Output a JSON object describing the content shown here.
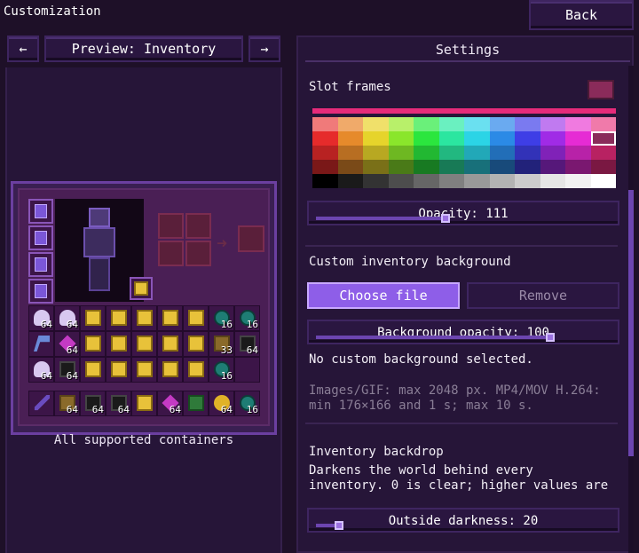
{
  "header": {
    "title": "Customization",
    "back_label": "Back"
  },
  "preview_nav": {
    "prev_icon": "arrow-left-icon",
    "prev_glyph": "←",
    "label": "Preview: Inventory",
    "next_icon": "arrow-right-icon",
    "next_glyph": "→"
  },
  "preview": {
    "caption": "All supported containers",
    "main_grid": [
      {
        "item": "potion",
        "count": "64"
      },
      {
        "item": "potion",
        "count": "64"
      },
      {
        "item": "totem",
        "count": ""
      },
      {
        "item": "totem",
        "count": ""
      },
      {
        "item": "totem",
        "count": ""
      },
      {
        "item": "totem",
        "count": ""
      },
      {
        "item": "totem",
        "count": ""
      },
      {
        "item": "pearl",
        "count": "16"
      },
      {
        "item": "pearl",
        "count": "16"
      },
      {
        "item": "axe",
        "count": ""
      },
      {
        "item": "crystal",
        "count": "64"
      },
      {
        "item": "totem",
        "count": ""
      },
      {
        "item": "totem",
        "count": ""
      },
      {
        "item": "totem",
        "count": ""
      },
      {
        "item": "totem",
        "count": ""
      },
      {
        "item": "totem",
        "count": ""
      },
      {
        "item": "anchor",
        "count": "33"
      },
      {
        "item": "block",
        "count": "64"
      },
      {
        "item": "potion",
        "count": "64"
      },
      {
        "item": "block",
        "count": "64"
      },
      {
        "item": "totem",
        "count": ""
      },
      {
        "item": "totem",
        "count": ""
      },
      {
        "item": "totem",
        "count": ""
      },
      {
        "item": "totem",
        "count": ""
      },
      {
        "item": "totem",
        "count": ""
      },
      {
        "item": "pearl",
        "count": "16"
      },
      {
        "item": "",
        "count": ""
      }
    ],
    "hotbar": [
      {
        "item": "sword",
        "count": ""
      },
      {
        "item": "anchor",
        "count": "64"
      },
      {
        "item": "block",
        "count": "64"
      },
      {
        "item": "block",
        "count": "64"
      },
      {
        "item": "totem",
        "count": ""
      },
      {
        "item": "crystal",
        "count": "64"
      },
      {
        "item": "emerald",
        "count": ""
      },
      {
        "item": "apple",
        "count": "64"
      },
      {
        "item": "pearl",
        "count": "16"
      }
    ]
  },
  "settings": {
    "heading": "Settings",
    "slot_frames_label": "Slot frames",
    "selected_color": "#8a2b5a",
    "opacity_slider": {
      "label": "Opacity: 111",
      "value": 111,
      "max": 255
    },
    "custom_bg_label": "Custom inventory background",
    "choose_file_label": "Choose file",
    "remove_label": "Remove",
    "bg_opacity_slider": {
      "label": "Background opacity: 100",
      "value": 100,
      "max": 100
    },
    "no_bg_text": "No custom background selected.",
    "formats_line1": "Images/GIF: max 2048 px. MP4/MOV H.264:",
    "formats_line2": "min 176×166 and 1 s; max 10 s.",
    "backdrop_label": "Inventory backdrop",
    "backdrop_desc1": "Darkens the world behind every",
    "backdrop_desc2": "inventory. 0 is clear; higher values are",
    "darkness_slider": {
      "label": "Outside darkness: 20",
      "value": 20,
      "max": 255
    }
  },
  "palette_colors": [
    "#f07a7a",
    "#f0aa6a",
    "#f0e06a",
    "#b8f06a",
    "#6af07a",
    "#6af0c0",
    "#6ae0f0",
    "#6aaaf0",
    "#7a7af0",
    "#c07af0",
    "#f07ae0",
    "#f07aaa",
    "#e62b2b",
    "#e68a2b",
    "#e6d42b",
    "#8ae62b",
    "#2be63e",
    "#2be6a0",
    "#2bd4e6",
    "#2b8ae6",
    "#3e3ee6",
    "#a02be6",
    "#e62bd4",
    "#8a2b5a",
    "#b82222",
    "#b86e22",
    "#b8a822",
    "#6eb822",
    "#22b832",
    "#22b880",
    "#22a8b8",
    "#226eb8",
    "#3232b8",
    "#8022b8",
    "#b822a8",
    "#b82262",
    "#7a1818",
    "#7a4a18",
    "#7a7018",
    "#4a7a18",
    "#187a22",
    "#187a56",
    "#18707a",
    "#184a7a",
    "#22227a",
    "#56187a",
    "#7a1870",
    "#7a1842",
    "#000000",
    "#1a1a1a",
    "#333333",
    "#4d4d4d",
    "#666666",
    "#808080",
    "#999999",
    "#b3b3b3",
    "#cccccc",
    "#e6e6e6",
    "#f2f2f2",
    "#ffffff"
  ]
}
